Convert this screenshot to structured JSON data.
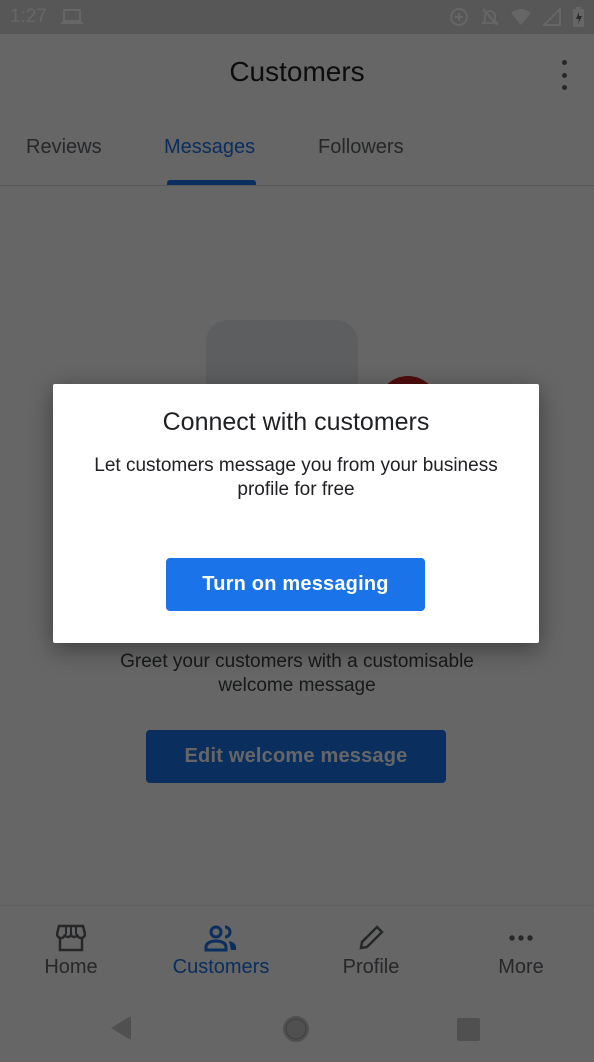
{
  "status_bar": {
    "time": "1:27",
    "icons": [
      "laptop-icon",
      "data-saver-icon",
      "notifications-off-icon",
      "wifi-icon",
      "cell-signal-icon",
      "battery-charging-icon"
    ]
  },
  "app_bar": {
    "title": "Customers",
    "overflow_icon": "more-vert-icon"
  },
  "tabs": [
    {
      "label": "Reviews",
      "active": false
    },
    {
      "label": "Messages",
      "active": true
    },
    {
      "label": "Followers",
      "active": false
    }
  ],
  "content": {
    "greeting_text": "Greet your customers with a customisable welcome message",
    "edit_button_label": "Edit welcome message"
  },
  "dialog": {
    "title": "Connect with customers",
    "body": "Let customers message you from your business profile for free",
    "primary_button_label": "Turn on messaging"
  },
  "bottom_nav": [
    {
      "label": "Home",
      "icon": "storefront-icon",
      "active": false
    },
    {
      "label": "Customers",
      "icon": "people-icon",
      "active": true
    },
    {
      "label": "Profile",
      "icon": "pencil-icon",
      "active": false
    },
    {
      "label": "More",
      "icon": "more-horiz-icon",
      "active": false
    }
  ],
  "system_nav": {
    "buttons": [
      "back-icon",
      "home-icon",
      "recents-icon"
    ]
  },
  "colors": {
    "accent": "#1a73e8",
    "scrim": "rgba(0,0,0,0.6)",
    "dialog_bg": "#ffffff"
  }
}
